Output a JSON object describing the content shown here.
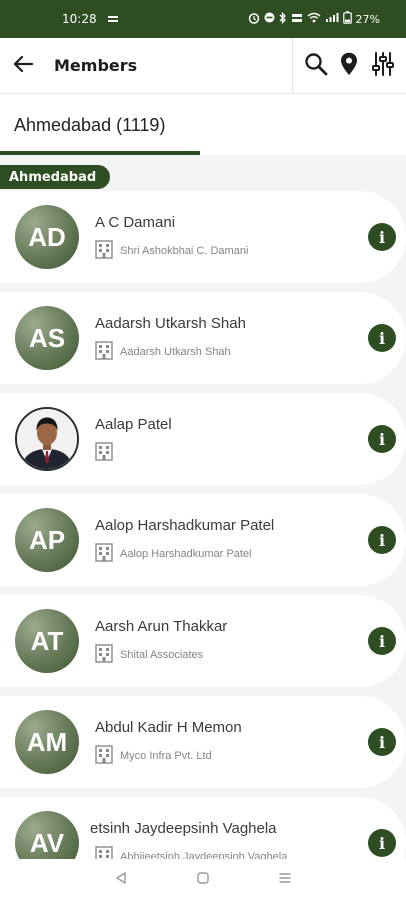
{
  "status_bar": {
    "time": "10:28",
    "battery": "27%"
  },
  "app_bar": {
    "title": "Members"
  },
  "tabs": [
    {
      "label": "Ahmedabad (1119)"
    }
  ],
  "section": {
    "label": "Ahmedabad"
  },
  "members": [
    {
      "initials": "AD",
      "name": "A C Damani",
      "company": "Shri Ashokbhai C. Damani",
      "photo": false
    },
    {
      "initials": "AS",
      "name": "Aadarsh Utkarsh Shah",
      "company": "Aadarsh Utkarsh Shah",
      "photo": false
    },
    {
      "initials": "",
      "name": "Aalap  Patel",
      "company": "",
      "photo": true
    },
    {
      "initials": "AP",
      "name": "Aalop Harshadkumar Patel",
      "company": "Aalop Harshadkumar Patel",
      "photo": false
    },
    {
      "initials": "AT",
      "name": "Aarsh Arun Thakkar",
      "company": "Shital Associates",
      "photo": false
    },
    {
      "initials": "AM",
      "name": "Abdul Kadir H Memon",
      "company": "Myco Infra Pvt. Ltd",
      "photo": false
    },
    {
      "initials": "AV",
      "name": "etsinh Jaydeepsinh Vaghela",
      "company": "Abhijeetsinh Jaydeepsinh Vaghela",
      "photo": false
    }
  ],
  "colors": {
    "primary": "#2e4d22",
    "card_bg": "#ffffff",
    "list_bg": "#f4f4f4"
  },
  "icons": [
    "back-arrow-icon",
    "search-icon",
    "location-pin-icon",
    "filter-sliders-icon",
    "building-icon",
    "info-icon"
  ]
}
